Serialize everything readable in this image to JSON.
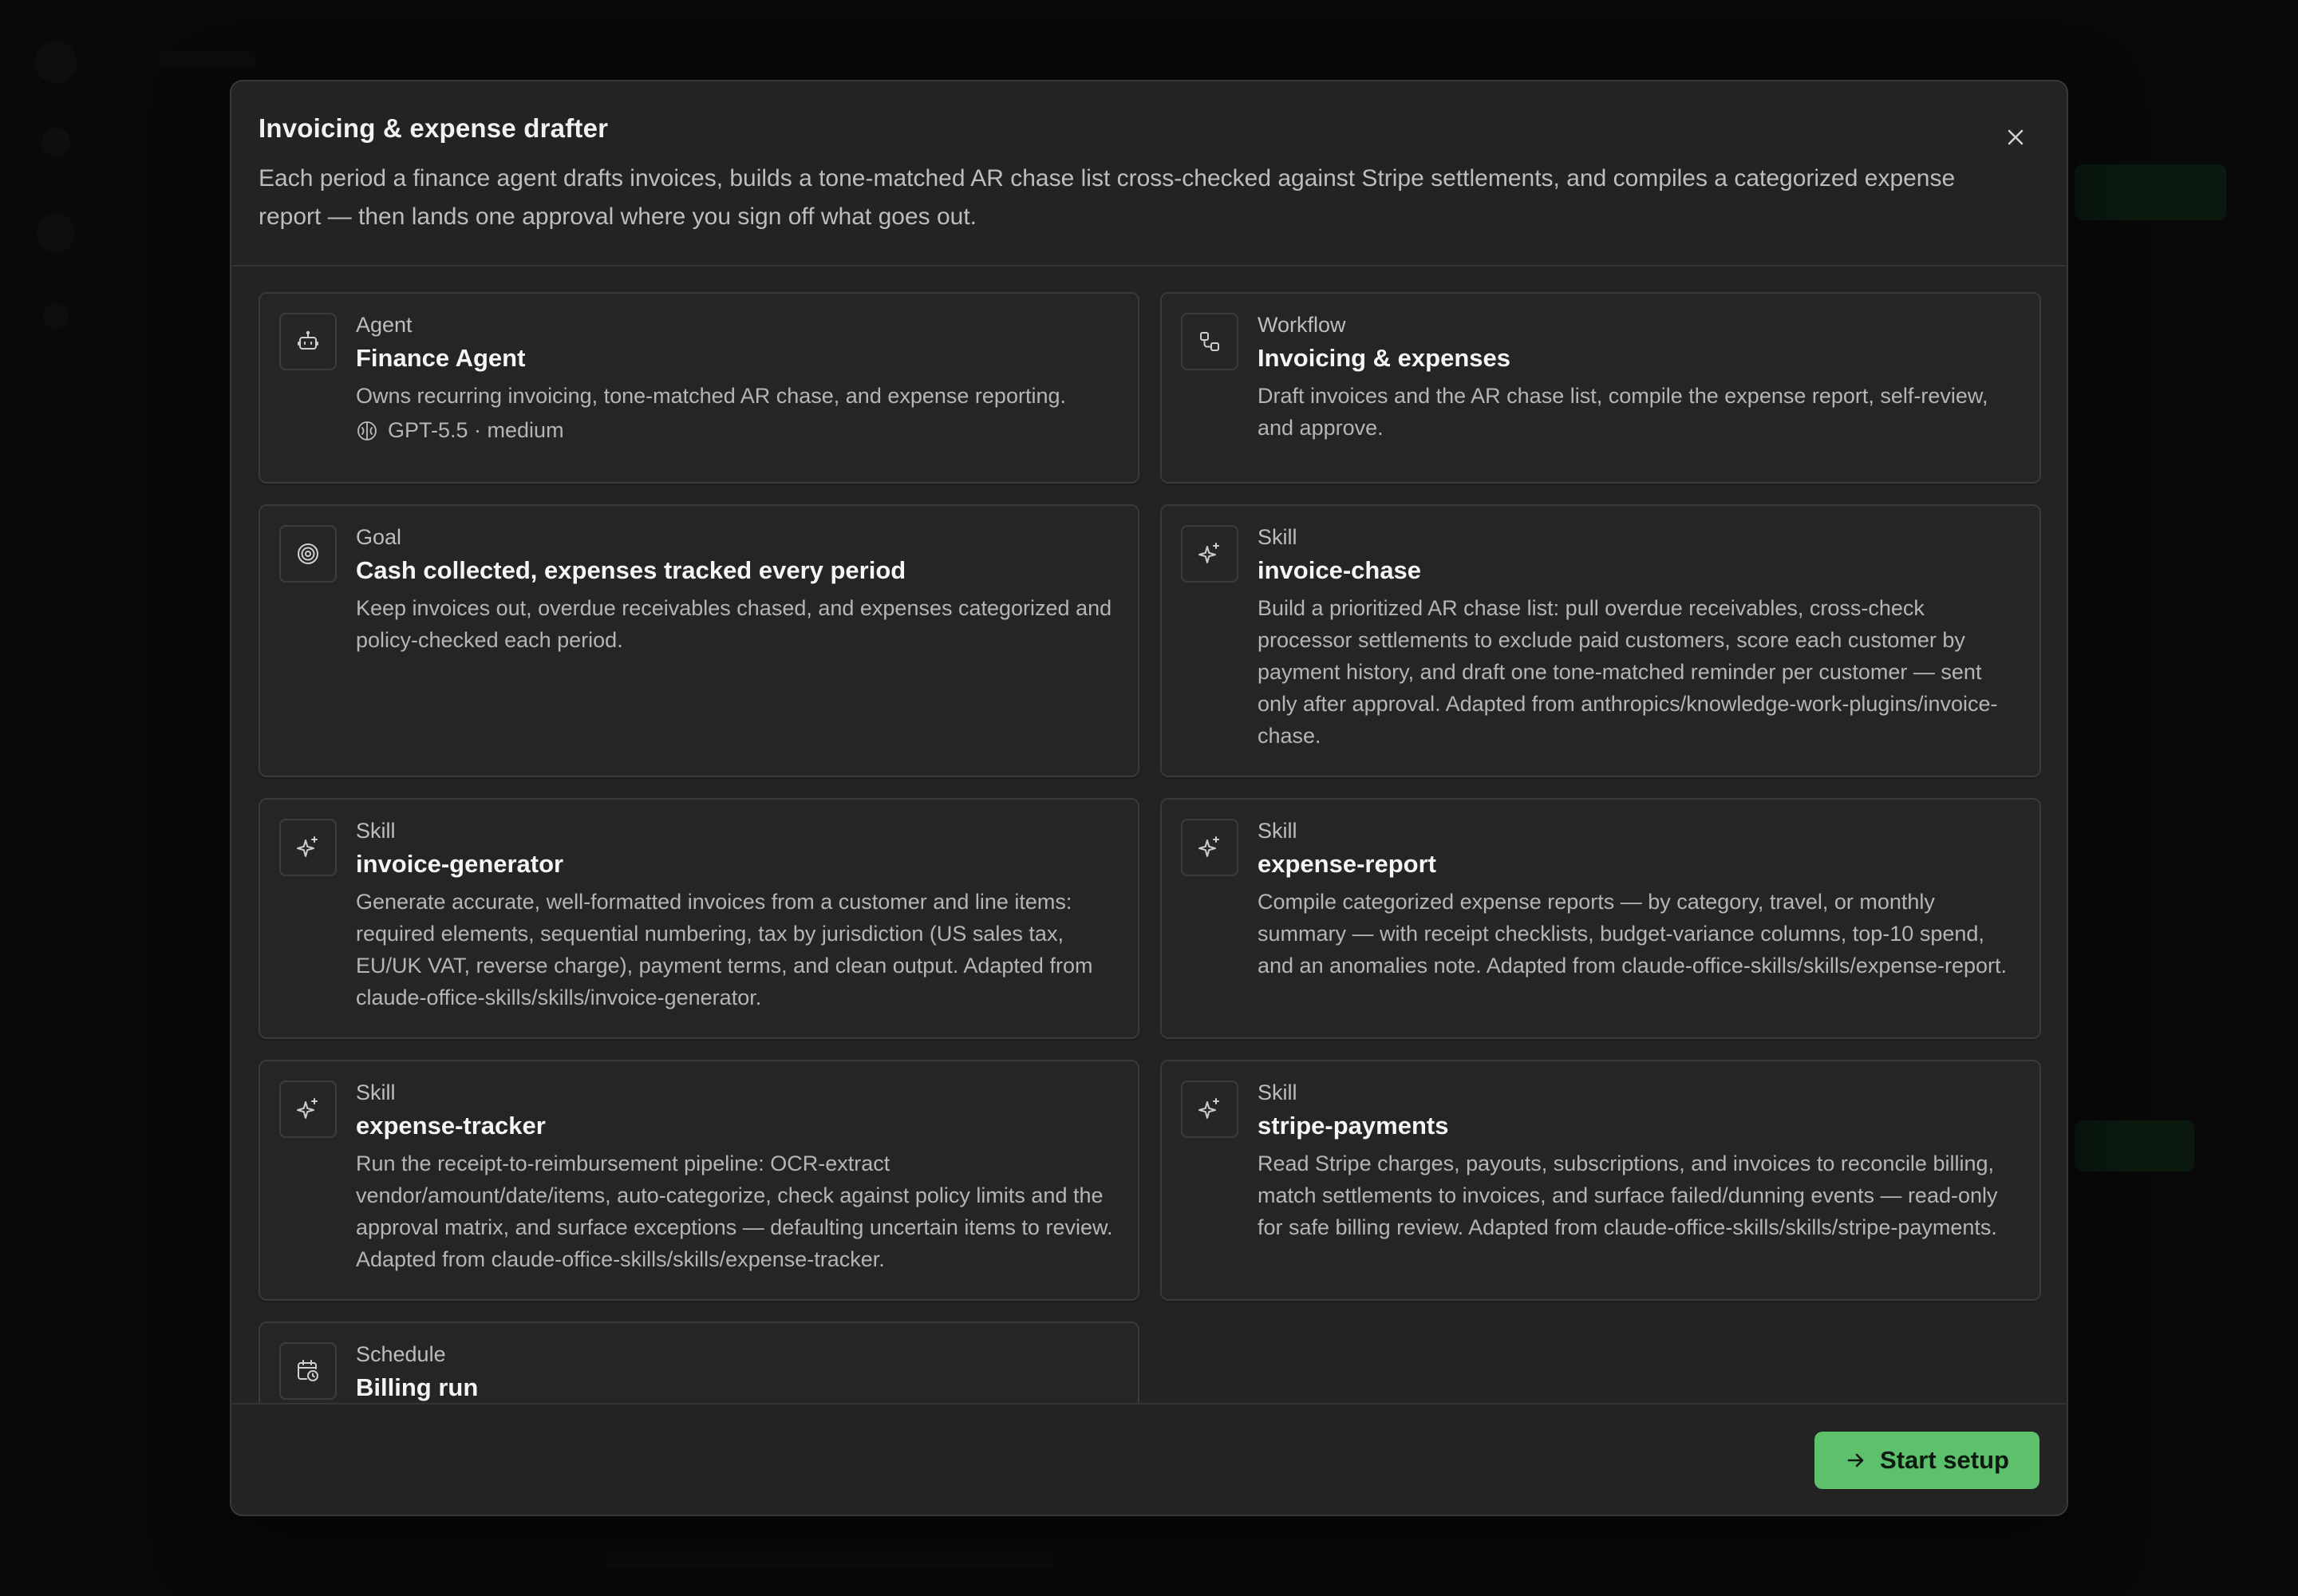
{
  "modal": {
    "title": "Invoicing & expense drafter",
    "description": "Each period a finance agent drafts invoices, builds a tone-matched AR chase list cross-checked against Stripe settlements, and compiles a categorized expense report — then lands one approval where you sign off what goes out."
  },
  "cards": [
    {
      "kind": "Agent",
      "title": "Finance Agent",
      "description": "Owns recurring invoicing, tone-matched AR chase, and expense reporting.",
      "meta": "GPT-5.5 · medium",
      "icon": "robot-icon"
    },
    {
      "kind": "Workflow",
      "title": "Invoicing & expenses",
      "description": "Draft invoices and the AR chase list, compile the expense report, self-review, and approve.",
      "icon": "workflow-icon"
    },
    {
      "kind": "Goal",
      "title": "Cash collected, expenses tracked every period",
      "description": "Keep invoices out, overdue receivables chased, and expenses categorized and policy-checked each period.",
      "icon": "target-icon"
    },
    {
      "kind": "Skill",
      "title": "invoice-chase",
      "description": "Build a prioritized AR chase list: pull overdue receivables, cross-check processor settlements to exclude paid customers, score each customer by payment history, and draft one tone-matched reminder per customer — sent only after approval. Adapted from anthropics/knowledge-work-plugins/invoice-chase.",
      "icon": "sparkle-icon"
    },
    {
      "kind": "Skill",
      "title": "invoice-generator",
      "description": "Generate accurate, well-formatted invoices from a customer and line items: required elements, sequential numbering, tax by jurisdiction (US sales tax, EU/UK VAT, reverse charge), payment terms, and clean output. Adapted from claude-office-skills/skills/invoice-generator.",
      "icon": "sparkle-icon"
    },
    {
      "kind": "Skill",
      "title": "expense-report",
      "description": "Compile categorized expense reports — by category, travel, or monthly summary — with receipt checklists, budget-variance columns, top-10 spend, and an anomalies note. Adapted from claude-office-skills/skills/expense-report.",
      "icon": "sparkle-icon"
    },
    {
      "kind": "Skill",
      "title": "expense-tracker",
      "description": "Run the receipt-to-reimbursement pipeline: OCR-extract vendor/amount/date/items, auto-categorize, check against policy limits and the approval matrix, and surface exceptions — defaulting uncertain items to review. Adapted from claude-office-skills/skills/expense-tracker.",
      "icon": "sparkle-icon"
    },
    {
      "kind": "Skill",
      "title": "stripe-payments",
      "description": "Read Stripe charges, payouts, subscriptions, and invoices to reconcile billing, match settlements to invoices, and surface failed/dunning events — read-only for safe billing review. Adapted from claude-office-skills/skills/stripe-payments.",
      "icon": "sparkle-icon"
    },
    {
      "kind": "Schedule",
      "title": "Billing run",
      "description": "",
      "icon": "calendar-clock-icon"
    }
  ],
  "footer": {
    "start_label": "Start setup"
  },
  "colors": {
    "accent": "#5cc06c",
    "modal_bg": "#232323",
    "card_border": "#3a3a3a"
  }
}
